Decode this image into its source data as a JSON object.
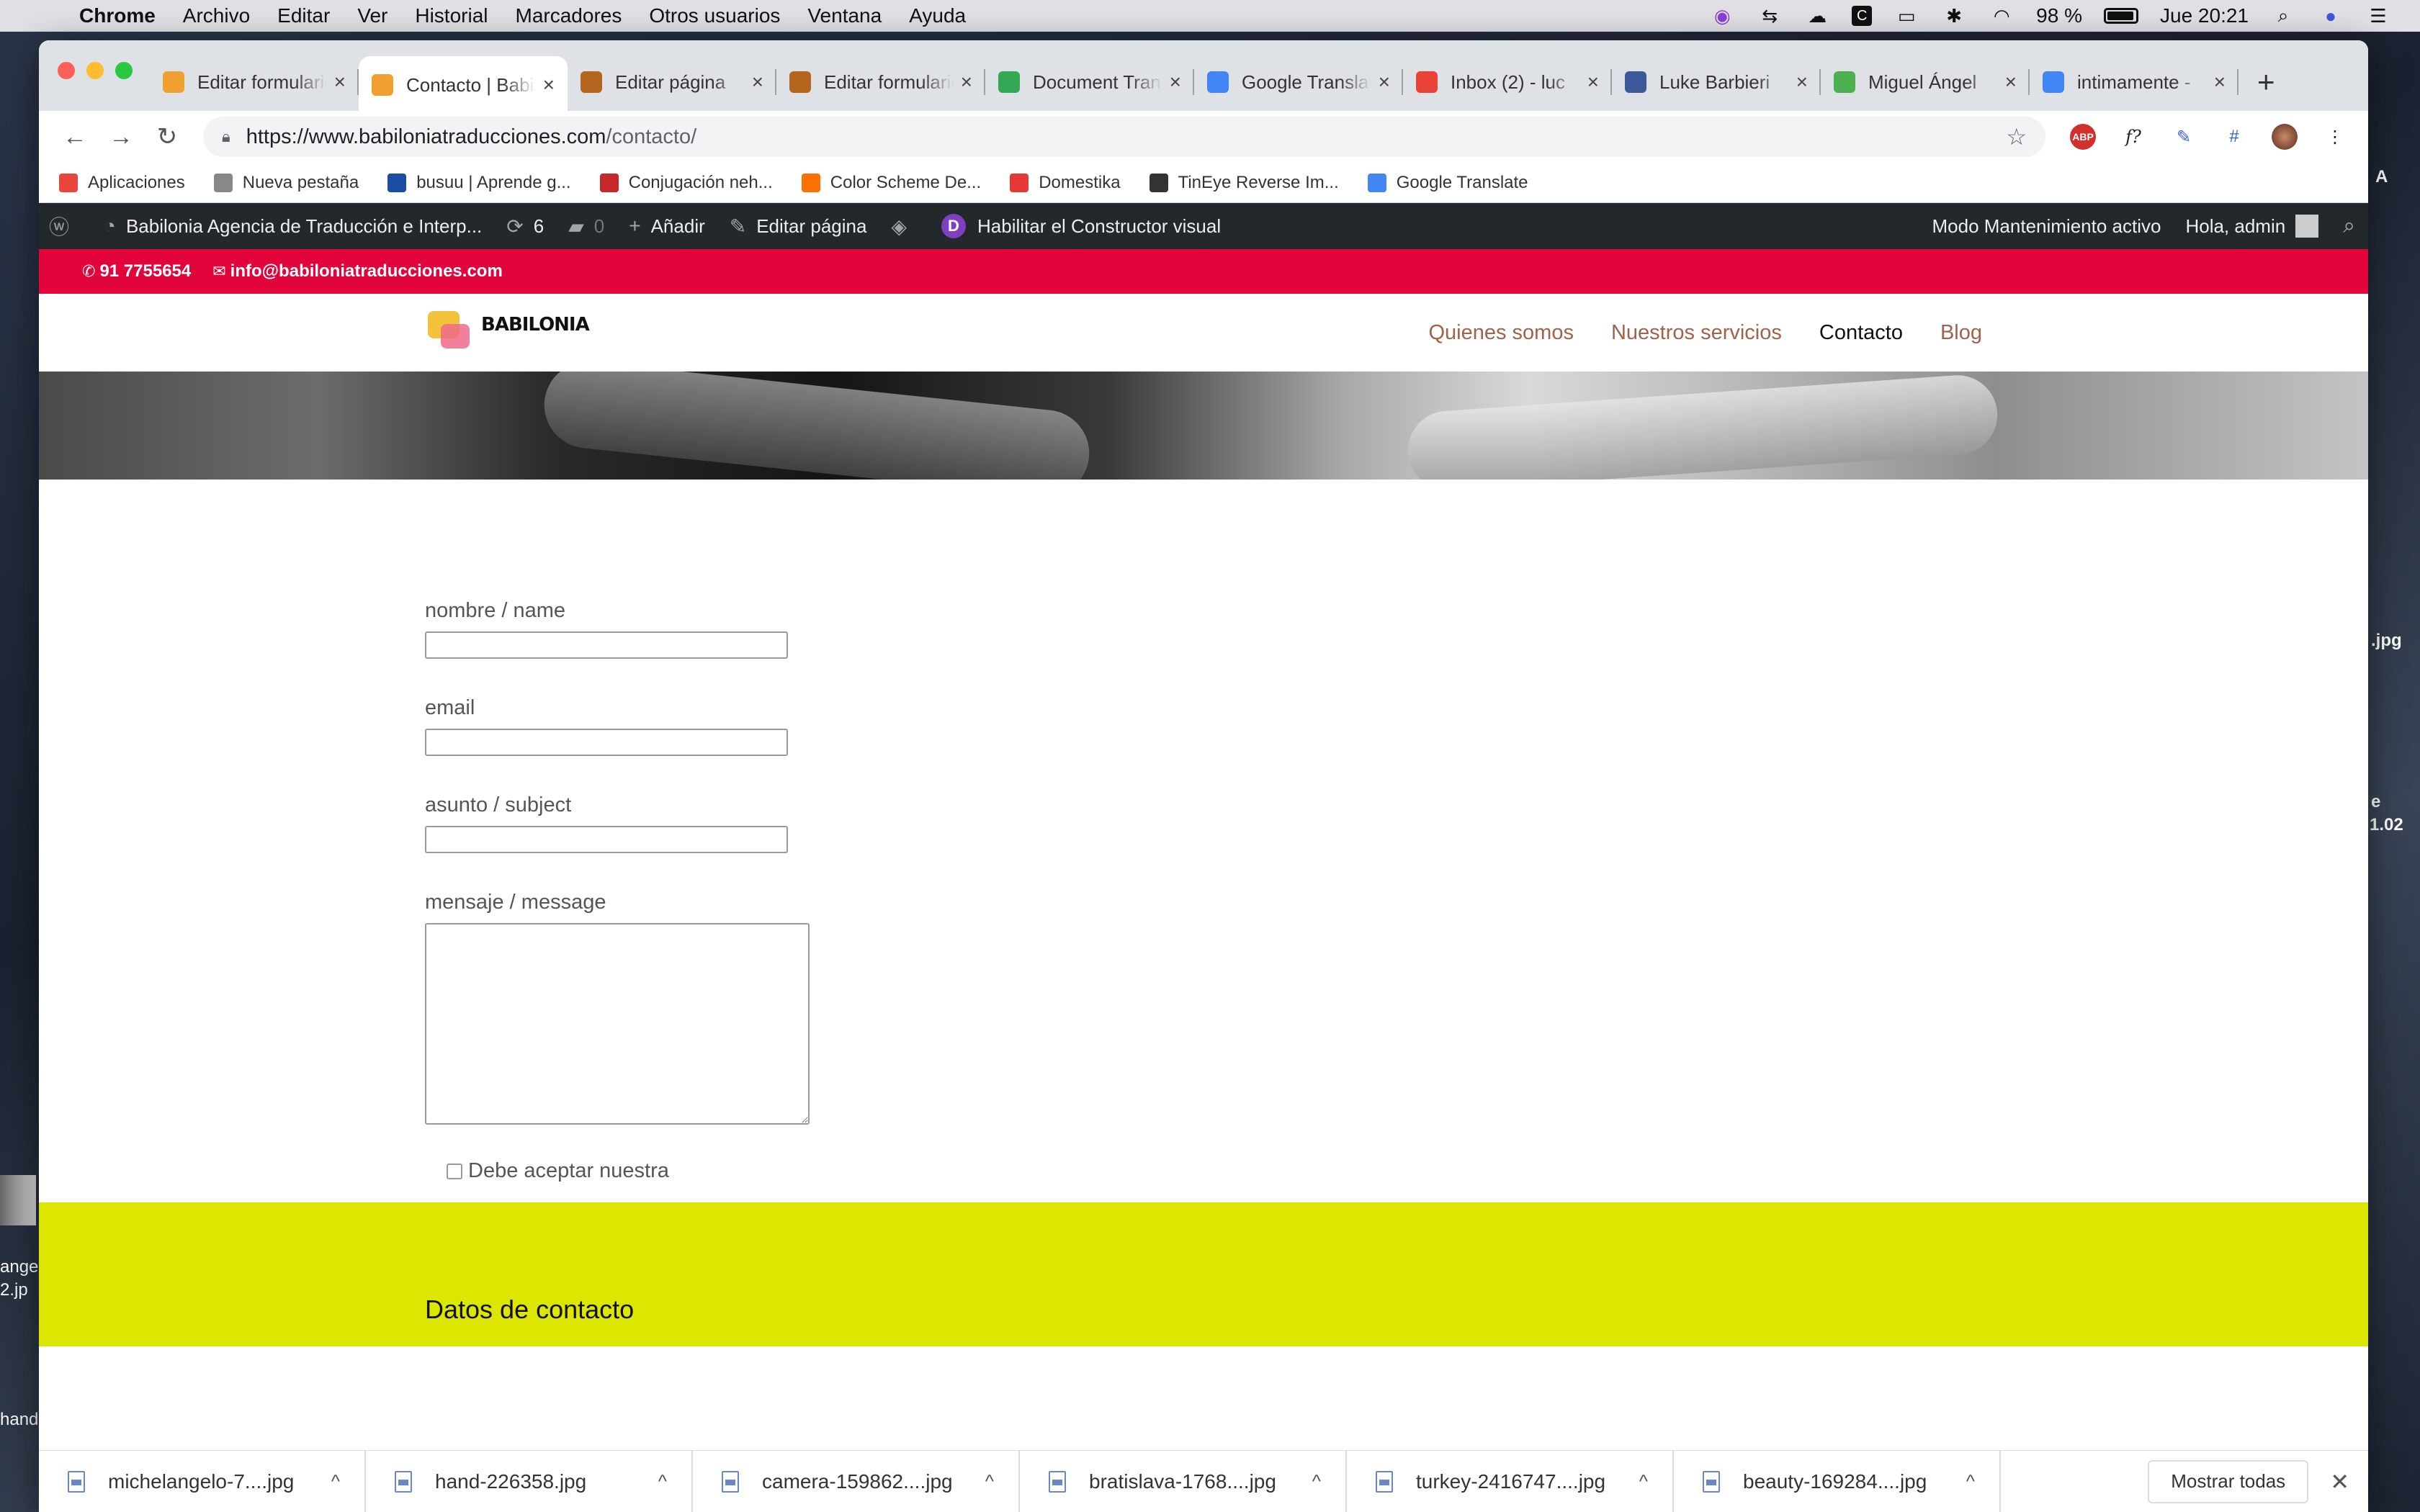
{
  "menubar": {
    "app": "Chrome",
    "items": [
      "Archivo",
      "Editar",
      "Ver",
      "Historial",
      "Marcadores",
      "Otros usuarios",
      "Ventana",
      "Ayuda"
    ],
    "battery": "98 %",
    "clock": "Jue 20:21"
  },
  "desktop": {
    "label_jpg": ".jpg",
    "label_102": "1.02",
    "label_ange": "ange",
    "label_2jp": "2.jp",
    "label_hand": "hand",
    "label_a": "A",
    "label_e": "e"
  },
  "tabs": [
    {
      "title": "Editar formulario",
      "icon_color": "#f0a030"
    },
    {
      "title": "Contacto | Babilonia",
      "icon_color": "#f0a030",
      "active": true
    },
    {
      "title": "Editar página",
      "icon_color": "#b5651d"
    },
    {
      "title": "Editar formulario",
      "icon_color": "#b5651d"
    },
    {
      "title": "Document Translator",
      "icon_color": "#34a853"
    },
    {
      "title": "Google Translate",
      "icon_color": "#4285f4"
    },
    {
      "title": "Inbox (2) - luc",
      "icon_color": "#ea4335"
    },
    {
      "title": "Luke Barbieri",
      "icon_color": "#3b5998"
    },
    {
      "title": "Miguel Ángel",
      "icon_color": "#4caf50"
    },
    {
      "title": "intimamente -",
      "icon_color": "#4285f4"
    }
  ],
  "toolbar": {
    "url_host": "https://www.babiloniatraducciones.com",
    "url_path": "/contacto/"
  },
  "bookmarks": [
    {
      "label": "Aplicaciones",
      "icon_color": "#e8453c"
    },
    {
      "label": "Nueva pestaña",
      "icon_color": "#888888"
    },
    {
      "label": "busuu | Aprende g...",
      "icon_color": "#1a4ea1"
    },
    {
      "label": "Conjugación neh...",
      "icon_color": "#c62828"
    },
    {
      "label": "Color Scheme De...",
      "icon_color": "#ff6f00"
    },
    {
      "label": "Domestika",
      "icon_color": "#e53935"
    },
    {
      "label": "TinEye Reverse Im...",
      "icon_color": "#333333"
    },
    {
      "label": "Google Translate",
      "icon_color": "#4285f4"
    }
  ],
  "wpbar": {
    "site_name": "Babilonia Agencia de Traducción e Interp...",
    "updates": "6",
    "comments": "0",
    "add_new": "Añadir",
    "edit_page": "Editar página",
    "visual_builder": "Habilitar el Constructor visual",
    "maintenance": "Modo Mantenimiento activo",
    "greeting": "Hola, admin"
  },
  "topbar": {
    "phone": "91 7755654",
    "email": "info@babiloniatraducciones.com"
  },
  "header": {
    "logo_text": "BABILONIA",
    "nav": [
      "Quienes somos",
      "Nuestros servicios",
      "Contacto",
      "Blog"
    ],
    "current": "Contacto"
  },
  "form": {
    "name_label": "nombre / name",
    "email_label": "email",
    "subject_label": "asunto / subject",
    "message_label": "mensaje / message",
    "accept_text": "Debe aceptar nuestra"
  },
  "footer": {
    "title": "Datos de contacto"
  },
  "downloads": {
    "items": [
      "michelangelo-7....jpg",
      "hand-226358.jpg",
      "camera-159862....jpg",
      "bratislava-1768....jpg",
      "turkey-2416747....jpg",
      "beauty-169284....jpg"
    ],
    "show_all": "Mostrar todas"
  }
}
